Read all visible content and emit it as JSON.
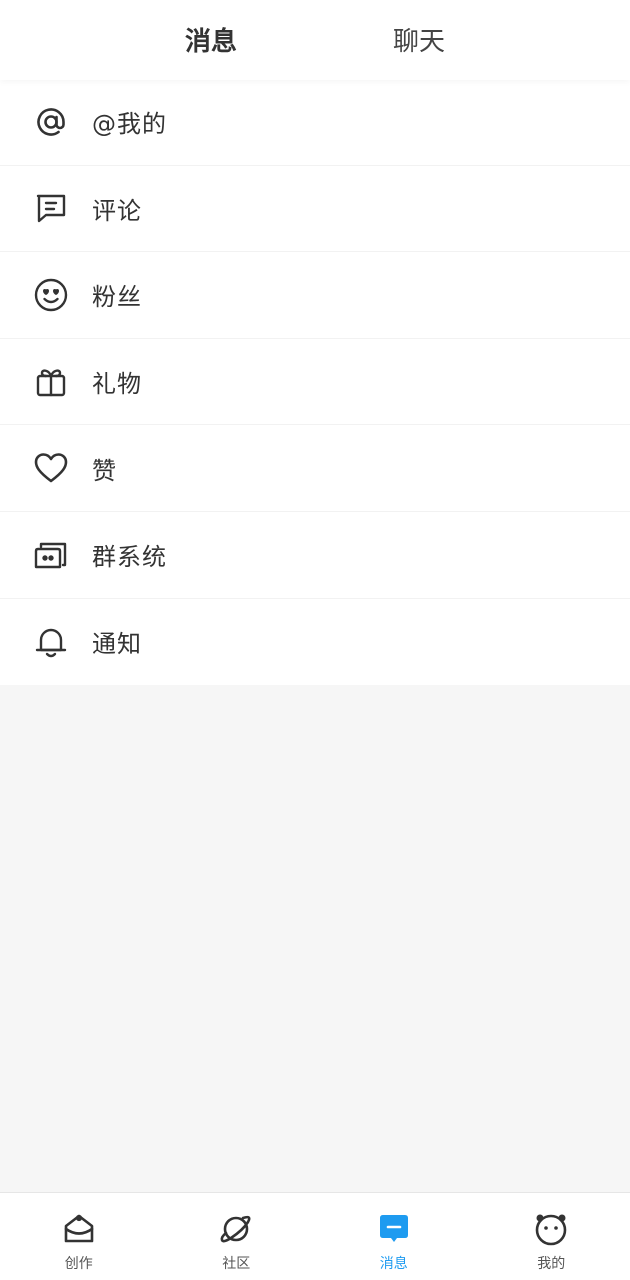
{
  "header": {
    "tabs": [
      {
        "label": "消息",
        "active": true
      },
      {
        "label": "聊天",
        "active": false
      }
    ]
  },
  "menu": {
    "items": [
      {
        "label": "@我的",
        "icon": "at-icon"
      },
      {
        "label": "评论",
        "icon": "comment-icon"
      },
      {
        "label": "粉丝",
        "icon": "smiley-heart-eyes-icon"
      },
      {
        "label": "礼物",
        "icon": "gift-icon"
      },
      {
        "label": "赞",
        "icon": "heart-icon"
      },
      {
        "label": "群系统",
        "icon": "group-robot-icon"
      },
      {
        "label": "通知",
        "icon": "bell-icon"
      }
    ]
  },
  "tabbar": {
    "items": [
      {
        "label": "创作",
        "icon": "create-icon",
        "active": false
      },
      {
        "label": "社区",
        "icon": "planet-icon",
        "active": false
      },
      {
        "label": "消息",
        "icon": "message-icon",
        "active": true
      },
      {
        "label": "我的",
        "icon": "panda-face-icon",
        "active": false
      }
    ]
  },
  "colors": {
    "accent": "#1e9bf0",
    "text": "#333333",
    "icon": "#333333",
    "background": "#f6f6f6"
  }
}
